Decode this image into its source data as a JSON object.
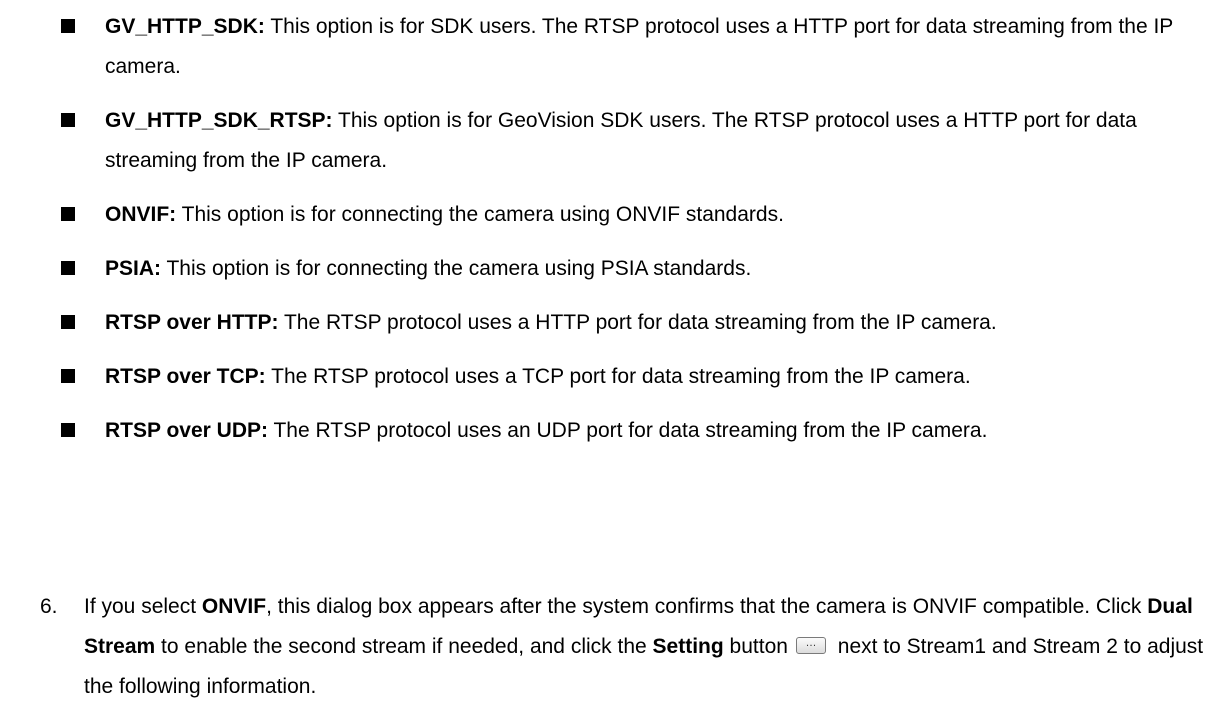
{
  "options": [
    {
      "term": "GV_HTTP_SDK:",
      "desc": " This option is for SDK users. The RTSP protocol uses a HTTP port for data streaming from the IP camera."
    },
    {
      "term": "GV_HTTP_SDK_RTSP:",
      "desc": " This option is for GeoVision SDK users. The RTSP protocol uses a HTTP port for data streaming from the IP camera."
    },
    {
      "term": "ONVIF:",
      "desc": " This option is for connecting the camera using ONVIF standards."
    },
    {
      "term": "PSIA:",
      "desc": " This option is for connecting the camera using PSIA standards."
    },
    {
      "term": "RTSP over HTTP:",
      "desc": " The RTSP protocol uses a HTTP port for data streaming from the IP camera."
    },
    {
      "term": "RTSP over TCP:",
      "desc": " The RTSP protocol uses a TCP port for data streaming from the IP camera."
    },
    {
      "term": "RTSP over UDP:",
      "desc": " The RTSP protocol uses an UDP port for data streaming from the IP camera."
    }
  ],
  "step6": {
    "number": "6.",
    "t1": "If you select ",
    "b1": "ONVIF",
    "t2": ", this dialog box appears after the system confirms that the camera is ONVIF compatible. Click ",
    "b2": "Dual Stream",
    "t3": " to enable the second stream if needed, and click the ",
    "b3": "Setting",
    "t4": " button",
    "button_glyph": "…",
    "t5": " next to Stream1 and Stream 2 to adjust the following information."
  }
}
